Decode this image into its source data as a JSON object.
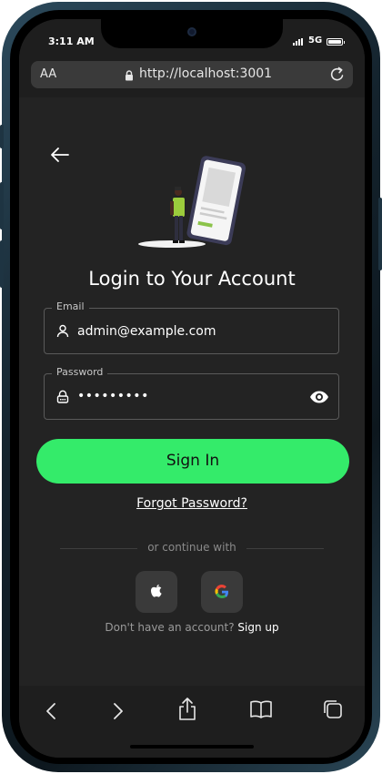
{
  "status_bar": {
    "time": "3:11 AM",
    "network": "5G"
  },
  "browser": {
    "text_size_label": "AA",
    "url": "http://localhost:3001"
  },
  "page": {
    "title": "Login to Your Account",
    "email": {
      "label": "Email",
      "value": "admin@example.com"
    },
    "password": {
      "label": "Password",
      "masked_value": "•••••••••"
    },
    "sign_in_label": "Sign In",
    "forgot_password_label": "Forgot Password?",
    "continue_with_label": "or continue with",
    "no_account_text": "Don't have an account?",
    "sign_up_label": "Sign up"
  },
  "colors": {
    "accent": "#34eb6a",
    "background": "#232323"
  },
  "icons": [
    "back-arrow-icon",
    "user-icon",
    "lock-icon",
    "eye-icon",
    "apple-icon",
    "google-icon",
    "reload-icon"
  ]
}
